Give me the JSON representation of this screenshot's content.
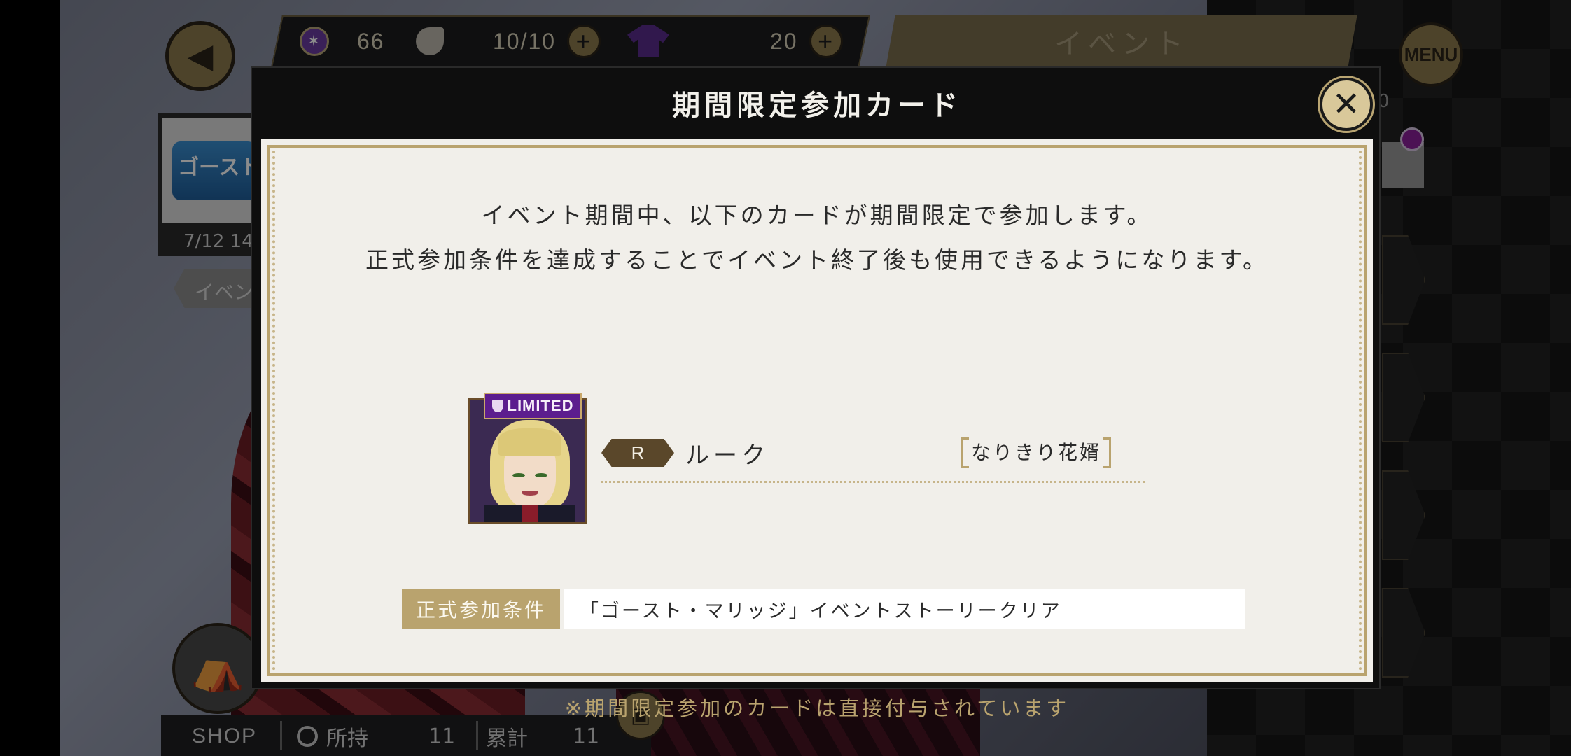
{
  "hud": {
    "gems": "66",
    "stamina": "10/10",
    "outfit_count": "20",
    "event_banner": "イベント",
    "menu_label": "MENU"
  },
  "left_panel": {
    "card_text": "ゴースト",
    "date": "7/12 14",
    "tag": "イベン"
  },
  "right_panel": {
    "partial_value": "0"
  },
  "bottom": {
    "shop_label": "SHOP",
    "owned_label": "所持",
    "owned_value": "11",
    "total_label": "累計",
    "total_value": "11"
  },
  "modal": {
    "title": "期間限定参加カード",
    "close_glyph": "✕",
    "description_line1": "イベント期間中、以下のカードが期間限定で参加します。",
    "description_line2": "正式参加条件を達成することでイベント終了後も使用できるようになります。",
    "card": {
      "badge": "LIMITED",
      "rarity": "R",
      "character_name": "ルーク",
      "card_title": "なりきり花婿"
    },
    "condition_label": "正式参加条件",
    "condition_value": "「ゴースト・マリッジ」イベントストーリークリア",
    "footnote": "※期間限定参加のカードは直接付与されています"
  },
  "icons": {
    "back": "chevron-left-icon",
    "gem": "gem-icon",
    "stamina": "leaf-icon",
    "outfit": "outfit-icon",
    "plus": "plus-icon",
    "close": "close-icon",
    "tent": "tent-icon",
    "chest": "chest-icon"
  },
  "colors": {
    "gold": "#b9a36e",
    "limited_purple": "#5c1d8e",
    "rarity_brown": "#5a472a",
    "panel_bg": "#f1efea"
  }
}
